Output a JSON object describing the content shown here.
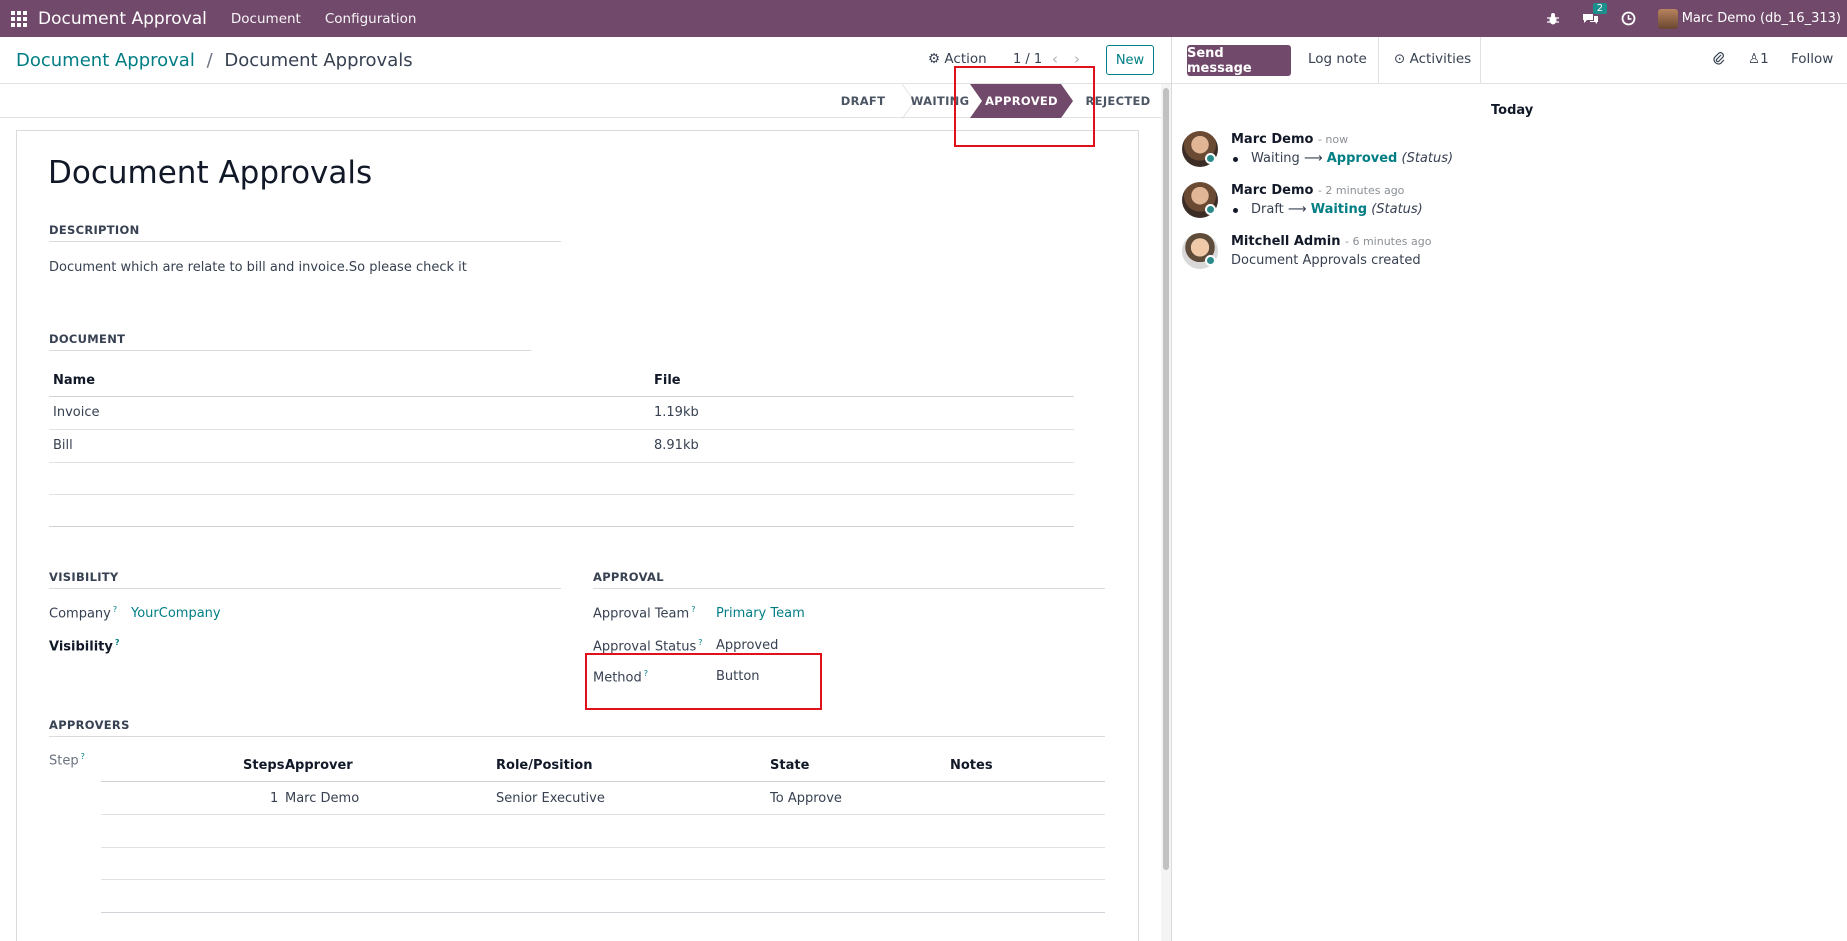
{
  "topbar": {
    "brand": "Document Approval",
    "menu": [
      "Document",
      "Configuration"
    ],
    "chat_badge": "2",
    "user": "Marc Demo (db_16_313)"
  },
  "control": {
    "breadcrumb_parent": "Document Approval",
    "breadcrumb_sep": "/",
    "breadcrumb_current": "Document Approvals",
    "action_label": "Action",
    "pager": "1 / 1",
    "new_label": "New"
  },
  "stages": [
    "DRAFT",
    "WAITING",
    "APPROVED",
    "REJECTED"
  ],
  "form": {
    "title": "Document Approvals",
    "description_header": "DESCRIPTION",
    "description": "Document which are relate to bill and invoice.So please check it",
    "document_header": "DOCUMENT",
    "doc_columns": [
      "Name",
      "File"
    ],
    "doc_rows": [
      {
        "name": "Invoice",
        "file": "1.19kb"
      },
      {
        "name": "Bill",
        "file": "8.91kb"
      }
    ],
    "visibility_header": "VISIBILITY",
    "company_label": "Company",
    "company_value": "YourCompany",
    "visibility_label": "Visibility",
    "approval_header": "APPROVAL",
    "team_label": "Approval Team",
    "team_value": "Primary Team",
    "status_label": "Approval Status",
    "status_value": "Approved",
    "method_label": "Method",
    "method_value": "Button",
    "approvers_header": "APPROVERS",
    "step_label": "Step",
    "step_columns": [
      "Steps",
      "Approver",
      "Role/Position",
      "State",
      "Notes"
    ],
    "step_rows": [
      {
        "step": "1",
        "approver": "Marc Demo",
        "role": "Senior Executive",
        "state": "To Approve",
        "notes": ""
      }
    ],
    "help_mark": "?"
  },
  "chatter": {
    "send_message": "Send message",
    "log_note": "Log note",
    "activities": "Activities",
    "followers_count": "1",
    "follow": "Follow",
    "today": "Today",
    "messages": [
      {
        "author": "Marc Demo",
        "time": "- now",
        "from": "Waiting",
        "to": "Approved",
        "field": "(Status)"
      },
      {
        "author": "Marc Demo",
        "time": "- 2 minutes ago",
        "from": "Draft",
        "to": "Waiting",
        "field": "(Status)"
      },
      {
        "author": "Mitchell Admin",
        "time": "- 6 minutes ago",
        "body": "Document Approvals created"
      }
    ]
  },
  "colors": {
    "brand": "#71496b",
    "accent": "#017e84",
    "highlight": "#e0111b"
  }
}
